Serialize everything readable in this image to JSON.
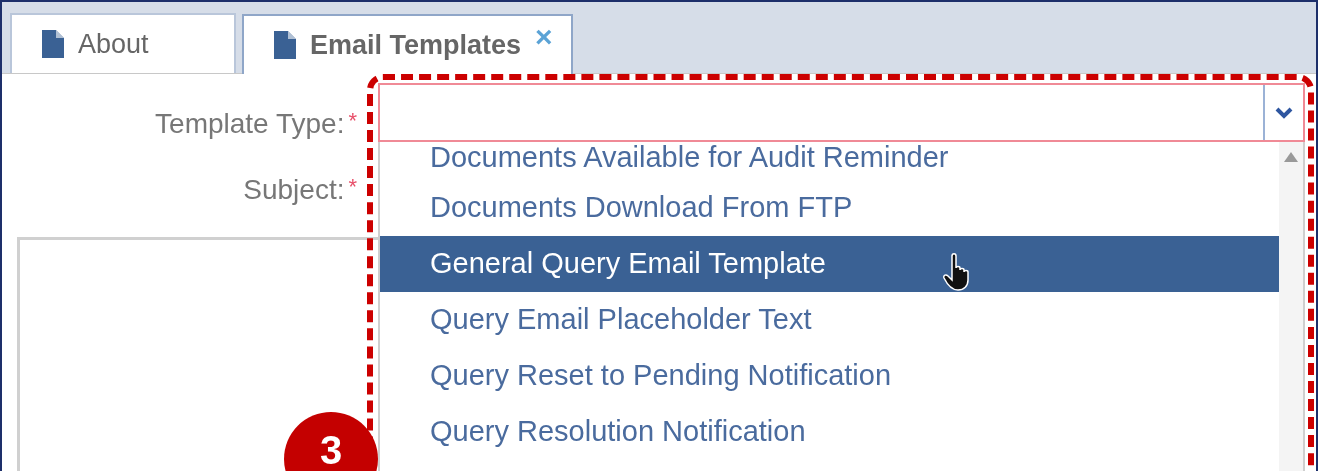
{
  "tabs": [
    {
      "label": "About",
      "selected": false
    },
    {
      "label": "Email Templates",
      "selected": true,
      "close": "×"
    }
  ],
  "form": {
    "fields": [
      {
        "label": "Template Type:",
        "required_mark": "*"
      },
      {
        "label": "Subject:",
        "required_mark": "*"
      }
    ]
  },
  "dropdown": {
    "items": [
      {
        "label": "Documents Available for Audit Reminder",
        "selected": false
      },
      {
        "label": "Documents Download From FTP",
        "selected": false
      },
      {
        "label": "General Query Email Template",
        "selected": true
      },
      {
        "label": "Query Email Placeholder Text",
        "selected": false
      },
      {
        "label": "Query Reset to Pending Notification",
        "selected": false
      },
      {
        "label": "Query Resolution Notification",
        "selected": false
      }
    ]
  },
  "annotation": {
    "badge": "3"
  }
}
